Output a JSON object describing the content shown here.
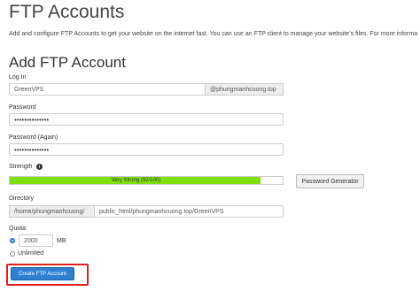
{
  "page": {
    "title": "FTP Accounts",
    "description": "Add and configure FTP Accounts to get your website on the internet fast. You can use an FTP client to manage your website’s files. For more informa"
  },
  "form": {
    "section_title": "Add FTP Account",
    "login": {
      "label": "Log In",
      "value": "GreenVPS",
      "domain_suffix": "@phungmanhcuong.top"
    },
    "password": {
      "label": "Password",
      "masked": "••••••••••••••"
    },
    "password_again": {
      "label": "Password (Again)",
      "masked": "••••••••••••••"
    },
    "strength": {
      "label": "Strength",
      "info_icon": "info-circle-icon",
      "text": "Very Strong (92/100)",
      "percent": 92,
      "color": "#7fe00a"
    },
    "password_generator_label": "Password Generator",
    "directory": {
      "label": "Directory",
      "prefix": "/home/phungmanhcuong/",
      "value": "public_html/phungmanhcuong.top/GreenVPS"
    },
    "quota": {
      "label": "Quota",
      "value": "2000",
      "unit": "MB",
      "unlimited_label": "Unlimited",
      "selected": "limited"
    },
    "submit_label": "Create FTP Account",
    "highlight_color": "#e01f1f",
    "button_color": "#2f80d1"
  }
}
